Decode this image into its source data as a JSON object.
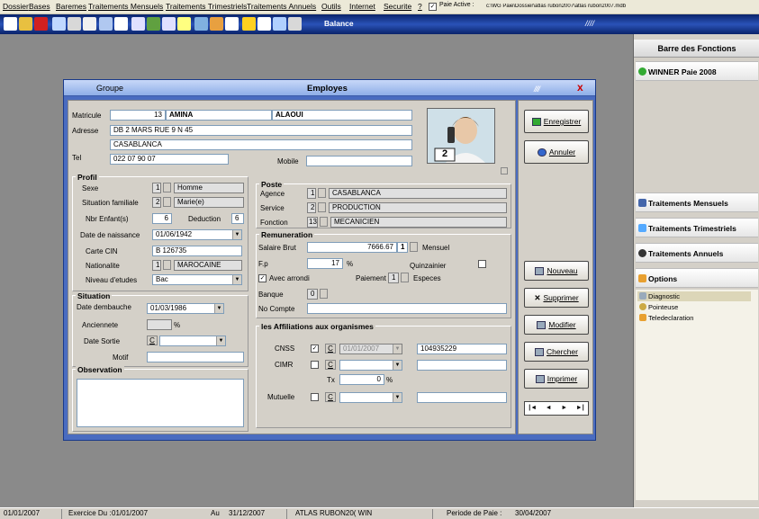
{
  "menu": [
    "Dossier",
    "Bases",
    "Baremes",
    "Traitements Mensuels",
    "Traitements Trimestriels",
    "Traitements Annuels",
    "Outils",
    "Internet",
    "Securite",
    "?"
  ],
  "paie_active": {
    "checked": true,
    "label": "Paie Active :",
    "path": "c:\\WG Paie\\Dossier\\atlas rubon2007\\atlas rubon2007.mdb"
  },
  "toolbar": {
    "balance_label": "Balance",
    "stripe": "////"
  },
  "window": {
    "group_label": "Groupe",
    "title": "Employes",
    "stripe": "////",
    "close": "x"
  },
  "fields": {
    "matricule_label": "Matricule",
    "matricule": "13",
    "nom": "AMINA",
    "prenom": "ALAOUI",
    "adresse_label": "Adresse",
    "adresse1": "DB 2 MARS RUE 9 N 45",
    "adresse2": "CASABLANCA",
    "tel_label": "Tel",
    "tel": "022 07 90 07",
    "mobile_label": "Mobile",
    "mobile": "",
    "photo_number": "2"
  },
  "profil": {
    "title": "Profil",
    "sexe_label": "Sexe",
    "sexe_code": "1",
    "sexe": "Homme",
    "situation_label": "Situation familiale",
    "situation_code": "2",
    "situation": "Marie(e)",
    "enfants_label": "Nbr Enfant(s)",
    "enfants": "6",
    "deduction_label": "Deduction",
    "deduction": "6",
    "naissance_label": "Date de naissance",
    "naissance": "01/06/1942",
    "cin_label": "Carte CIN",
    "cin": "B 126735",
    "nationalite_label": "Nationalite",
    "nationalite_code": "1",
    "nationalite": "MAROCAINE",
    "etudes_label": "Niveau d'etudes",
    "etudes": "Bac"
  },
  "situation": {
    "title": "Situation",
    "embauche_label": "Date dembauche",
    "embauche": "01/03/1986",
    "anciennete_label": "Anciennete",
    "anciennete": "",
    "anciennete_unit": "%",
    "sortie_label": "Date Sortie",
    "sortie_c": "C",
    "motif_label": "Motif",
    "motif": ""
  },
  "observation": {
    "title": "Observation",
    "value": ""
  },
  "poste": {
    "title": "Poste",
    "agence_label": "Agence",
    "agence_code": "1",
    "agence": "CASABLANCA",
    "service_label": "Service",
    "service_code": "2",
    "service": "PRODUCTION",
    "fonction_label": "Fonction",
    "fonction_code": "13",
    "fonction": "MECANICIEN"
  },
  "remuneration": {
    "title": "Remuneration",
    "salaire_label": "Salaire Brut",
    "salaire": "7666.67",
    "salaire_code": "1",
    "mensuel_label": "Mensuel",
    "fp_label": "F.p",
    "fp": "17",
    "fp_unit": "%",
    "quinzainier_label": "Quinzainier",
    "arrondi_label": "Avec arrondi",
    "paiement_label": "Paiement",
    "paiement_code": "1",
    "paiement": "Especes",
    "banque_label": "Banque",
    "banque_code": "0",
    "compte_label": "No Compte",
    "compte": ""
  },
  "affiliations": {
    "title": "les Affiliations aux organismes",
    "cnss_label": "CNSS",
    "cnss_c": "C",
    "cnss_date": "01/01/2007",
    "cnss_num": "104935229",
    "cimr_label": "CIMR",
    "cimr_c": "C",
    "tx_label": "Tx",
    "tx": "0",
    "tx_unit": "%",
    "mutuelle_label": "Mutuelle",
    "mutuelle_c": "C"
  },
  "buttons": {
    "enregistrer": "Enregistrer",
    "annuler": "Annuler",
    "nouveau": "Nouveau",
    "supprimer": "Supprimer",
    "modifier": "Modifier",
    "chercher": "Chercher",
    "imprimer": "Imprimer",
    "nav": [
      "|◄",
      "◄",
      "►",
      "►|"
    ]
  },
  "sidebar": {
    "header": "Barre des Fonctions",
    "app": "WINNER Paie 2008",
    "sections": [
      "Traitements Mensuels",
      "Traitements Trimestriels",
      "Traitements Annuels",
      "Options"
    ],
    "options_items": [
      "Diagnostic",
      "Pointeuse",
      "Teledeclaration"
    ]
  },
  "status": {
    "date": "01/01/2007",
    "exercice_label": "Exercice Du :",
    "exercice_from": "01/01/2007",
    "au_label": "Au",
    "exercice_to": "31/12/2007",
    "company": "ATLAS RUBON20( WIN",
    "periode_label": "Periode de Paie :",
    "periode": "30/04/2007"
  },
  "colors": {
    "title_bar": "#8eaee8",
    "window_bg": "#4a6cc0",
    "toolbar": "#0a246a",
    "form_bg": "#d4d0c8"
  }
}
